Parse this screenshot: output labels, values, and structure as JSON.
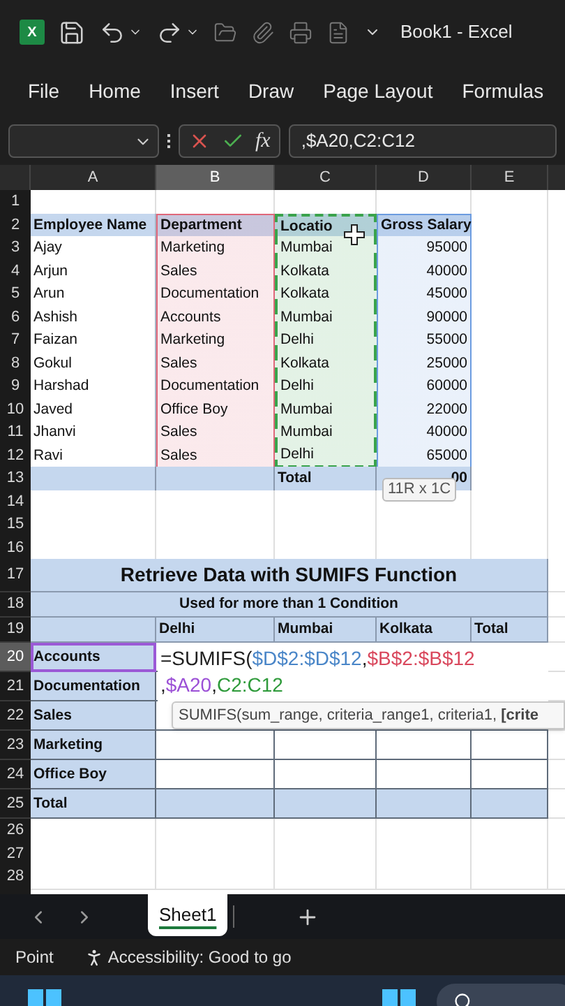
{
  "title_bar": {
    "logo_text": "X",
    "title": "Book1 - Excel"
  },
  "menu": [
    "File",
    "Home",
    "Insert",
    "Draw",
    "Page Layout",
    "Formulas"
  ],
  "formula_bar": {
    "fx": "fx",
    "value": ",$A20,C2:C12"
  },
  "grid": {
    "columns": [
      {
        "label": "A",
        "selected": false,
        "marquee": false
      },
      {
        "label": "B",
        "selected": true,
        "color": "#e0677a",
        "marquee": false
      },
      {
        "label": "C",
        "selected": false,
        "color": "#3aa34c",
        "marquee": true
      },
      {
        "label": "D",
        "selected": false,
        "color": "#6c9ce0",
        "marquee": false
      },
      {
        "label": "E",
        "selected": false,
        "marquee": false
      }
    ],
    "rows": [
      {
        "number": "1",
        "selected": false,
        "kind": "blank",
        "cells": [
          "",
          "",
          "",
          "",
          ""
        ]
      },
      {
        "number": "2",
        "selected": false,
        "kind": "table_header",
        "cells": [
          "Employee Name",
          "Department",
          "Locatio",
          "Gross Salary",
          ""
        ]
      },
      {
        "number": "3",
        "selected": false,
        "kind": "table_row",
        "cells": [
          "Ajay",
          "Marketing",
          "Mumbai",
          "95000",
          ""
        ]
      },
      {
        "number": "4",
        "selected": false,
        "kind": "table_row",
        "cells": [
          "Arjun",
          "Sales",
          "Kolkata",
          "40000",
          ""
        ]
      },
      {
        "number": "5",
        "selected": false,
        "kind": "table_row",
        "cells": [
          "Arun",
          "Documentation",
          "Kolkata",
          "45000",
          ""
        ]
      },
      {
        "number": "6",
        "selected": false,
        "kind": "table_row",
        "cells": [
          "Ashish",
          "Accounts",
          "Mumbai",
          "90000",
          ""
        ]
      },
      {
        "number": "7",
        "selected": false,
        "kind": "table_row",
        "cells": [
          "Faizan",
          "Marketing",
          "Delhi",
          "55000",
          ""
        ]
      },
      {
        "number": "8",
        "selected": false,
        "kind": "table_row",
        "cells": [
          "Gokul",
          "Sales",
          "Kolkata",
          "25000",
          ""
        ]
      },
      {
        "number": "9",
        "selected": false,
        "kind": "table_row",
        "cells": [
          "Harshad",
          "Documentation",
          "Delhi",
          "60000",
          ""
        ]
      },
      {
        "number": "10",
        "selected": false,
        "kind": "table_row",
        "cells": [
          "Javed",
          "Office Boy",
          "Mumbai",
          "22000",
          ""
        ]
      },
      {
        "number": "11",
        "selected": false,
        "kind": "table_row",
        "cells": [
          "Jhanvi",
          "Sales",
          "Mumbai",
          "40000",
          ""
        ]
      },
      {
        "number": "12",
        "selected": false,
        "kind": "table_row",
        "cells": [
          "Ravi",
          "Sales",
          "Delhi",
          "65000",
          ""
        ]
      },
      {
        "number": "13",
        "selected": false,
        "kind": "table_total",
        "cells": [
          "",
          "",
          "Total",
          "00",
          ""
        ]
      },
      {
        "number": "14",
        "selected": false,
        "kind": "blank",
        "cells": [
          "",
          "",
          "",
          "",
          ""
        ]
      },
      {
        "number": "15",
        "selected": false,
        "kind": "blank",
        "cells": [
          "",
          "",
          "",
          "",
          ""
        ]
      },
      {
        "number": "16",
        "selected": false,
        "kind": "blank",
        "cells": [
          "",
          "",
          "",
          "",
          ""
        ]
      },
      {
        "number": "17",
        "selected": false,
        "kind": "title",
        "text": "Retrieve Data with SUMIFS Function"
      },
      {
        "number": "18",
        "selected": false,
        "kind": "subtitle",
        "text": "Used for more than 1 Condition"
      },
      {
        "number": "19",
        "selected": false,
        "kind": "summary_header",
        "cells": [
          "",
          "Delhi",
          "Mumbai",
          "Kolkata",
          "Total"
        ]
      },
      {
        "number": "20",
        "selected": true,
        "kind": "summary_row",
        "color": "#9b59d6",
        "cells": [
          "Accounts"
        ]
      },
      {
        "number": "21",
        "selected": false,
        "kind": "summary_row",
        "cells": [
          "Documentation"
        ]
      },
      {
        "number": "22",
        "selected": false,
        "kind": "summary_row",
        "cells": [
          "Sales",
          "",
          "",
          "",
          ""
        ]
      },
      {
        "number": "23",
        "selected": false,
        "kind": "summary_row",
        "cells": [
          "Marketing",
          "",
          "",
          "",
          ""
        ]
      },
      {
        "number": "24",
        "selected": false,
        "kind": "summary_row",
        "cells": [
          "Office Boy",
          "",
          "",
          "",
          ""
        ]
      },
      {
        "number": "25",
        "selected": false,
        "kind": "summary_total",
        "cells": [
          "Total",
          "",
          "",
          "",
          ""
        ]
      },
      {
        "number": "26",
        "selected": false,
        "kind": "blank",
        "cells": [
          "",
          "",
          "",
          "",
          ""
        ]
      },
      {
        "number": "27",
        "selected": false,
        "kind": "blank",
        "cells": [
          "",
          "",
          "",
          "",
          ""
        ]
      },
      {
        "number": "28",
        "selected": false,
        "kind": "blank",
        "cells": [
          "",
          "",
          "",
          "",
          ""
        ]
      }
    ]
  },
  "cell_editor": {
    "lines": [
      [
        {
          "text": "=SUMIFS(",
          "color": "#1f1f1f"
        },
        {
          "text": "$D$2:$D$12",
          "color": "#4a86c8"
        },
        {
          "prefix": ",",
          "text": "$B$2:$B$12",
          "color": "#d9475c"
        }
      ],
      [
        {
          "prefix": ",",
          "text": "$A20",
          "color": "#9b4fd6"
        },
        {
          "prefix": ",",
          "text": "C2:C12",
          "color": "#2e9a3a"
        }
      ]
    ]
  },
  "selection_tooltip": "11R x 1C",
  "function_tooltip": "SUMIFS(sum_range, criteria_range1, criteria1, **[crite**",
  "sheet_tabs": [
    {
      "label": "Sheet1",
      "selected": true
    }
  ],
  "status_bar": {
    "mode": "Point",
    "accessibility": "Accessibility: Good to go"
  }
}
